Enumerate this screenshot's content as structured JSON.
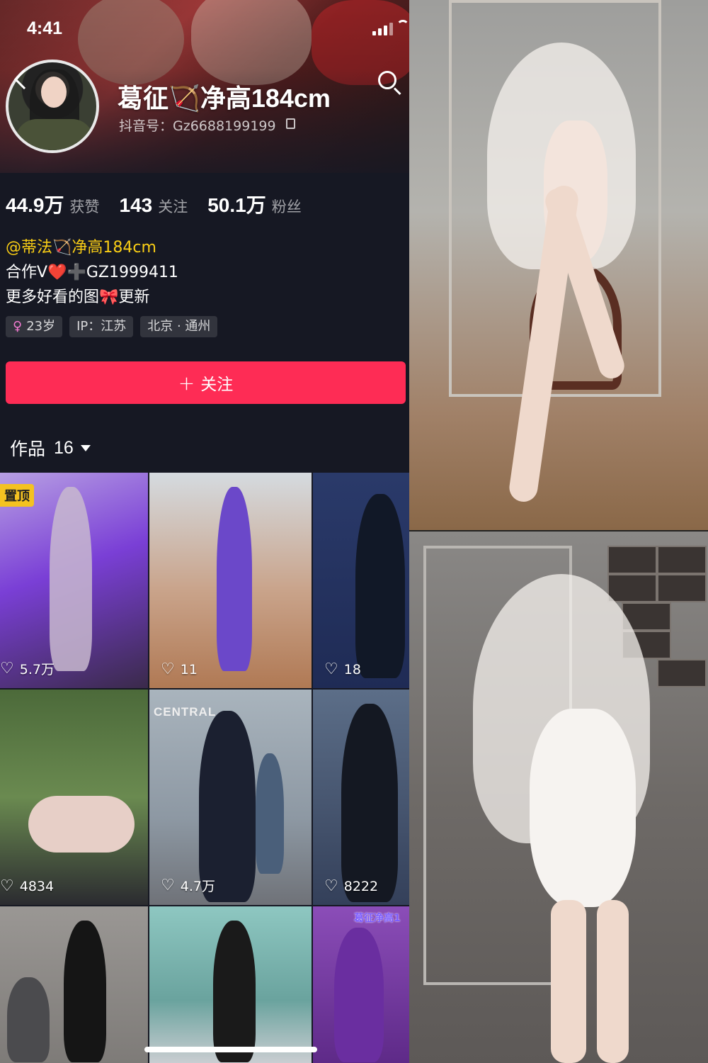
{
  "status_bar": {
    "time": "4:41"
  },
  "profile": {
    "name": "葛征🏹净高184cm",
    "douyin_id": "抖音号：Gz6688199199",
    "stats": [
      {
        "value": "44.9万",
        "label": "获赞"
      },
      {
        "value": "143",
        "label": "关注"
      },
      {
        "value": "50.1万",
        "label": "粉丝"
      }
    ],
    "bio_lines": [
      "@蒂法🏹净高184cm",
      "合作V❤️➕GZ1999411",
      "更多好看的图🎀更新"
    ],
    "tags": [
      "23岁",
      "IP：江苏",
      "北京 · 通州"
    ],
    "follow_button": "关注"
  },
  "works_tab": {
    "label": "作品",
    "count": "16"
  },
  "videos": [
    {
      "likes": "5.7万",
      "pinned": "置顶",
      "color": "#7a3fd6"
    },
    {
      "likes": "11",
      "color": "#6b48c9"
    },
    {
      "likes": "18",
      "color": "#1f2b55"
    },
    {
      "likes": "4834",
      "color": "#5a7046"
    },
    {
      "likes": "4.7万",
      "color": "#5d6e7f"
    },
    {
      "likes": "8222",
      "color": "#34405a"
    },
    {
      "color": "#7e7b78"
    },
    {
      "color": "#6aa39e"
    },
    {
      "color": "#5e2a88",
      "label": "葛征净高1"
    }
  ],
  "grid_labels": {
    "central": "CENTRAL"
  },
  "colors": {
    "accent": "#fe2c55",
    "mention": "#face15",
    "background": "#161823"
  }
}
